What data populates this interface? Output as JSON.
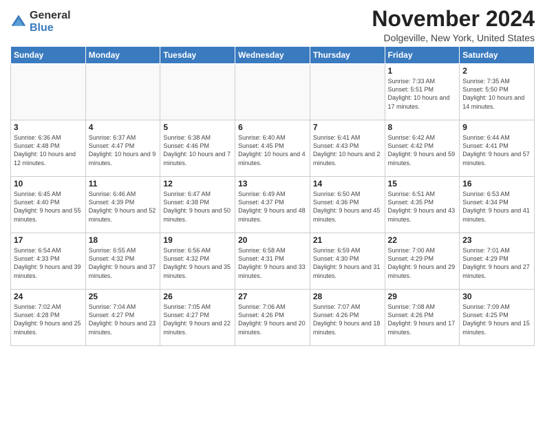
{
  "logo": {
    "general": "General",
    "blue": "Blue"
  },
  "title": "November 2024",
  "location": "Dolgeville, New York, United States",
  "days_header": [
    "Sunday",
    "Monday",
    "Tuesday",
    "Wednesday",
    "Thursday",
    "Friday",
    "Saturday"
  ],
  "weeks": [
    [
      {
        "num": "",
        "info": ""
      },
      {
        "num": "",
        "info": ""
      },
      {
        "num": "",
        "info": ""
      },
      {
        "num": "",
        "info": ""
      },
      {
        "num": "",
        "info": ""
      },
      {
        "num": "1",
        "info": "Sunrise: 7:33 AM\nSunset: 5:51 PM\nDaylight: 10 hours and 17 minutes."
      },
      {
        "num": "2",
        "info": "Sunrise: 7:35 AM\nSunset: 5:50 PM\nDaylight: 10 hours and 14 minutes."
      }
    ],
    [
      {
        "num": "3",
        "info": "Sunrise: 6:36 AM\nSunset: 4:48 PM\nDaylight: 10 hours and 12 minutes."
      },
      {
        "num": "4",
        "info": "Sunrise: 6:37 AM\nSunset: 4:47 PM\nDaylight: 10 hours and 9 minutes."
      },
      {
        "num": "5",
        "info": "Sunrise: 6:38 AM\nSunset: 4:46 PM\nDaylight: 10 hours and 7 minutes."
      },
      {
        "num": "6",
        "info": "Sunrise: 6:40 AM\nSunset: 4:45 PM\nDaylight: 10 hours and 4 minutes."
      },
      {
        "num": "7",
        "info": "Sunrise: 6:41 AM\nSunset: 4:43 PM\nDaylight: 10 hours and 2 minutes."
      },
      {
        "num": "8",
        "info": "Sunrise: 6:42 AM\nSunset: 4:42 PM\nDaylight: 9 hours and 59 minutes."
      },
      {
        "num": "9",
        "info": "Sunrise: 6:44 AM\nSunset: 4:41 PM\nDaylight: 9 hours and 57 minutes."
      }
    ],
    [
      {
        "num": "10",
        "info": "Sunrise: 6:45 AM\nSunset: 4:40 PM\nDaylight: 9 hours and 55 minutes."
      },
      {
        "num": "11",
        "info": "Sunrise: 6:46 AM\nSunset: 4:39 PM\nDaylight: 9 hours and 52 minutes."
      },
      {
        "num": "12",
        "info": "Sunrise: 6:47 AM\nSunset: 4:38 PM\nDaylight: 9 hours and 50 minutes."
      },
      {
        "num": "13",
        "info": "Sunrise: 6:49 AM\nSunset: 4:37 PM\nDaylight: 9 hours and 48 minutes."
      },
      {
        "num": "14",
        "info": "Sunrise: 6:50 AM\nSunset: 4:36 PM\nDaylight: 9 hours and 45 minutes."
      },
      {
        "num": "15",
        "info": "Sunrise: 6:51 AM\nSunset: 4:35 PM\nDaylight: 9 hours and 43 minutes."
      },
      {
        "num": "16",
        "info": "Sunrise: 6:53 AM\nSunset: 4:34 PM\nDaylight: 9 hours and 41 minutes."
      }
    ],
    [
      {
        "num": "17",
        "info": "Sunrise: 6:54 AM\nSunset: 4:33 PM\nDaylight: 9 hours and 39 minutes."
      },
      {
        "num": "18",
        "info": "Sunrise: 6:55 AM\nSunset: 4:32 PM\nDaylight: 9 hours and 37 minutes."
      },
      {
        "num": "19",
        "info": "Sunrise: 6:56 AM\nSunset: 4:32 PM\nDaylight: 9 hours and 35 minutes."
      },
      {
        "num": "20",
        "info": "Sunrise: 6:58 AM\nSunset: 4:31 PM\nDaylight: 9 hours and 33 minutes."
      },
      {
        "num": "21",
        "info": "Sunrise: 6:59 AM\nSunset: 4:30 PM\nDaylight: 9 hours and 31 minutes."
      },
      {
        "num": "22",
        "info": "Sunrise: 7:00 AM\nSunset: 4:29 PM\nDaylight: 9 hours and 29 minutes."
      },
      {
        "num": "23",
        "info": "Sunrise: 7:01 AM\nSunset: 4:29 PM\nDaylight: 9 hours and 27 minutes."
      }
    ],
    [
      {
        "num": "24",
        "info": "Sunrise: 7:02 AM\nSunset: 4:28 PM\nDaylight: 9 hours and 25 minutes."
      },
      {
        "num": "25",
        "info": "Sunrise: 7:04 AM\nSunset: 4:27 PM\nDaylight: 9 hours and 23 minutes."
      },
      {
        "num": "26",
        "info": "Sunrise: 7:05 AM\nSunset: 4:27 PM\nDaylight: 9 hours and 22 minutes."
      },
      {
        "num": "27",
        "info": "Sunrise: 7:06 AM\nSunset: 4:26 PM\nDaylight: 9 hours and 20 minutes."
      },
      {
        "num": "28",
        "info": "Sunrise: 7:07 AM\nSunset: 4:26 PM\nDaylight: 9 hours and 18 minutes."
      },
      {
        "num": "29",
        "info": "Sunrise: 7:08 AM\nSunset: 4:26 PM\nDaylight: 9 hours and 17 minutes."
      },
      {
        "num": "30",
        "info": "Sunrise: 7:09 AM\nSunset: 4:25 PM\nDaylight: 9 hours and 15 minutes."
      }
    ]
  ]
}
